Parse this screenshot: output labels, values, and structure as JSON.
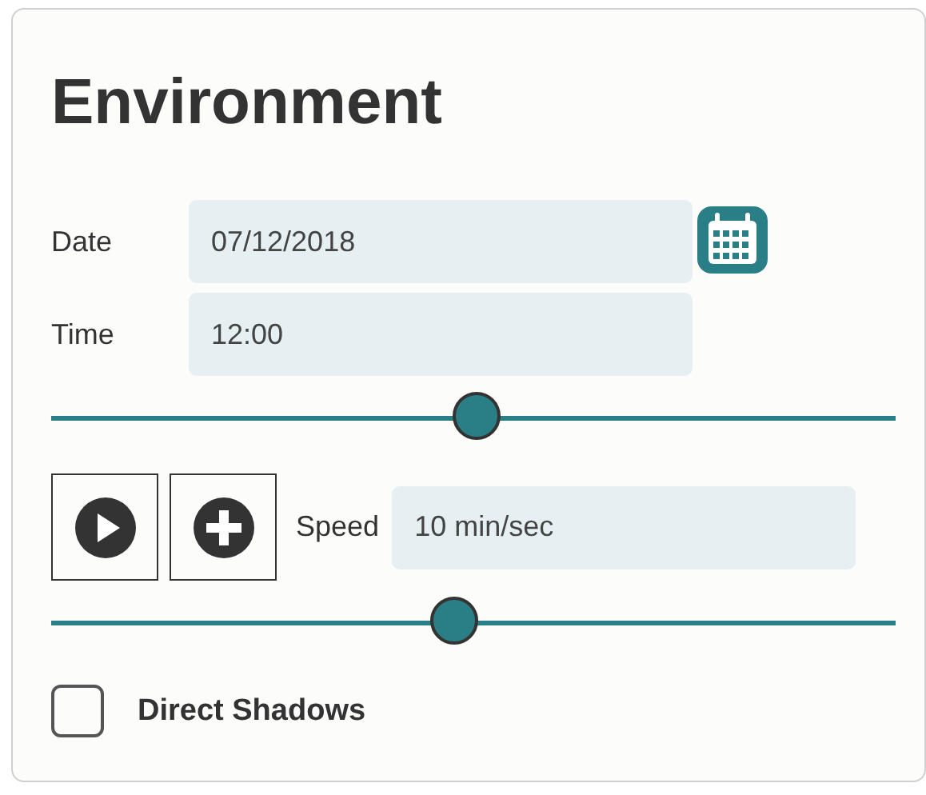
{
  "title": "Environment",
  "date": {
    "label": "Date",
    "value": "07/12/2018"
  },
  "time": {
    "label": "Time",
    "value": "12:00"
  },
  "time_slider": {
    "level": 0.504
  },
  "speed": {
    "label": "Speed",
    "value": "10 min/sec"
  },
  "speed_slider": {
    "level": 0.478
  },
  "direct_shadows": {
    "label": "Direct Shadows",
    "checked": false
  }
}
